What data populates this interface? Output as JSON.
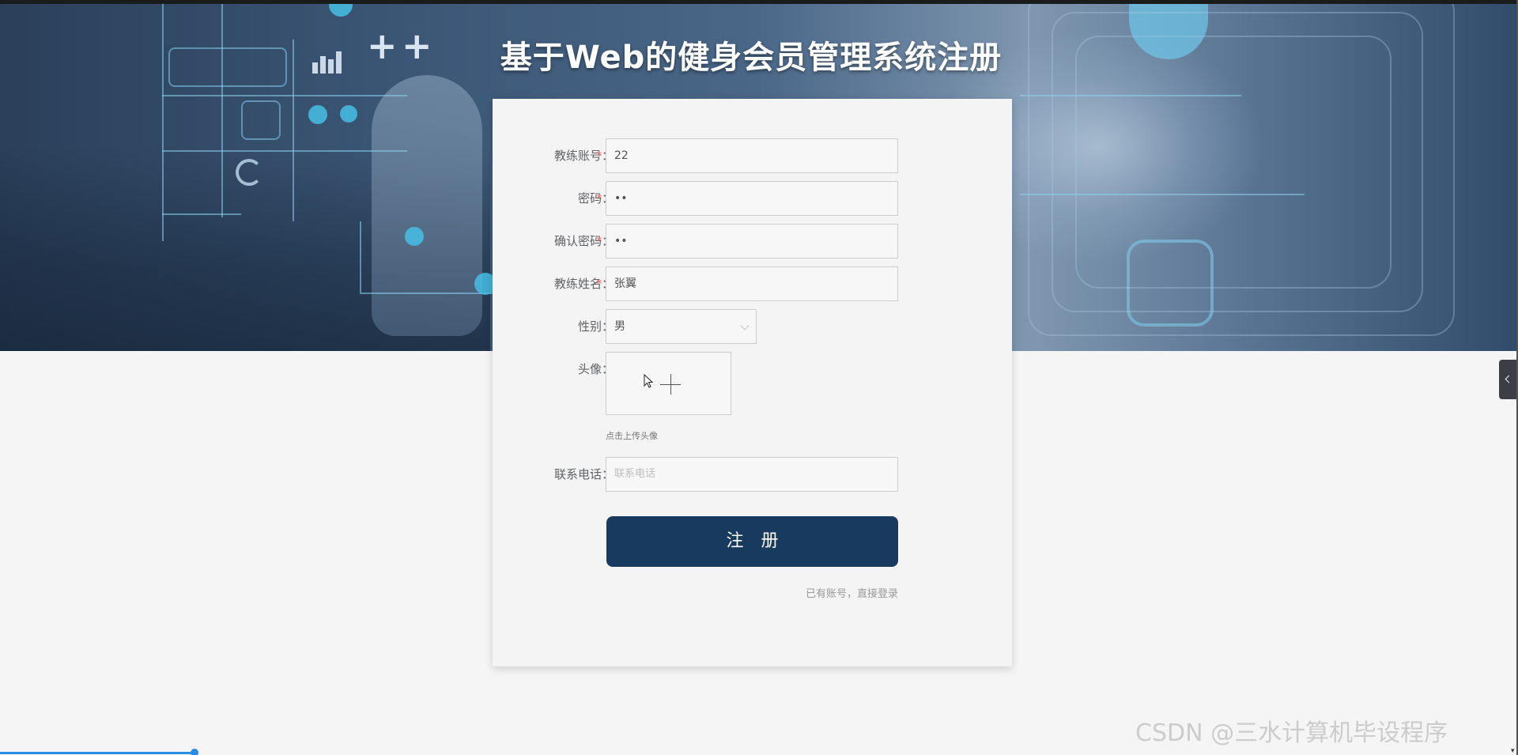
{
  "page_title": "基于Web的健身会员管理系统注册",
  "form": {
    "account": {
      "label": "教练账号：",
      "required": "*",
      "value": "22"
    },
    "password": {
      "label": "密码：",
      "required": "*",
      "value": "••"
    },
    "confirm_password": {
      "label": "确认密码：",
      "required": "*",
      "value": "••"
    },
    "name": {
      "label": "教练姓名：",
      "required": "*",
      "value": "张翼"
    },
    "gender": {
      "label": "性别：",
      "value": "男"
    },
    "avatar": {
      "label": "头像：",
      "hint": "点击上传头像"
    },
    "phone": {
      "label": "联系电话：",
      "placeholder": "联系电话"
    }
  },
  "submit_label": "注册",
  "login_link": "已有账号，直接登录",
  "watermark": "CSDN @三水计算机毕设程序",
  "colors": {
    "primary": "#173a5e",
    "required": "#f56c6c",
    "background": "#f5f5f5"
  },
  "icons": [
    "plus-icon",
    "chevron-down-icon",
    "chevron-left-icon",
    "pointer-cursor-icon"
  ]
}
